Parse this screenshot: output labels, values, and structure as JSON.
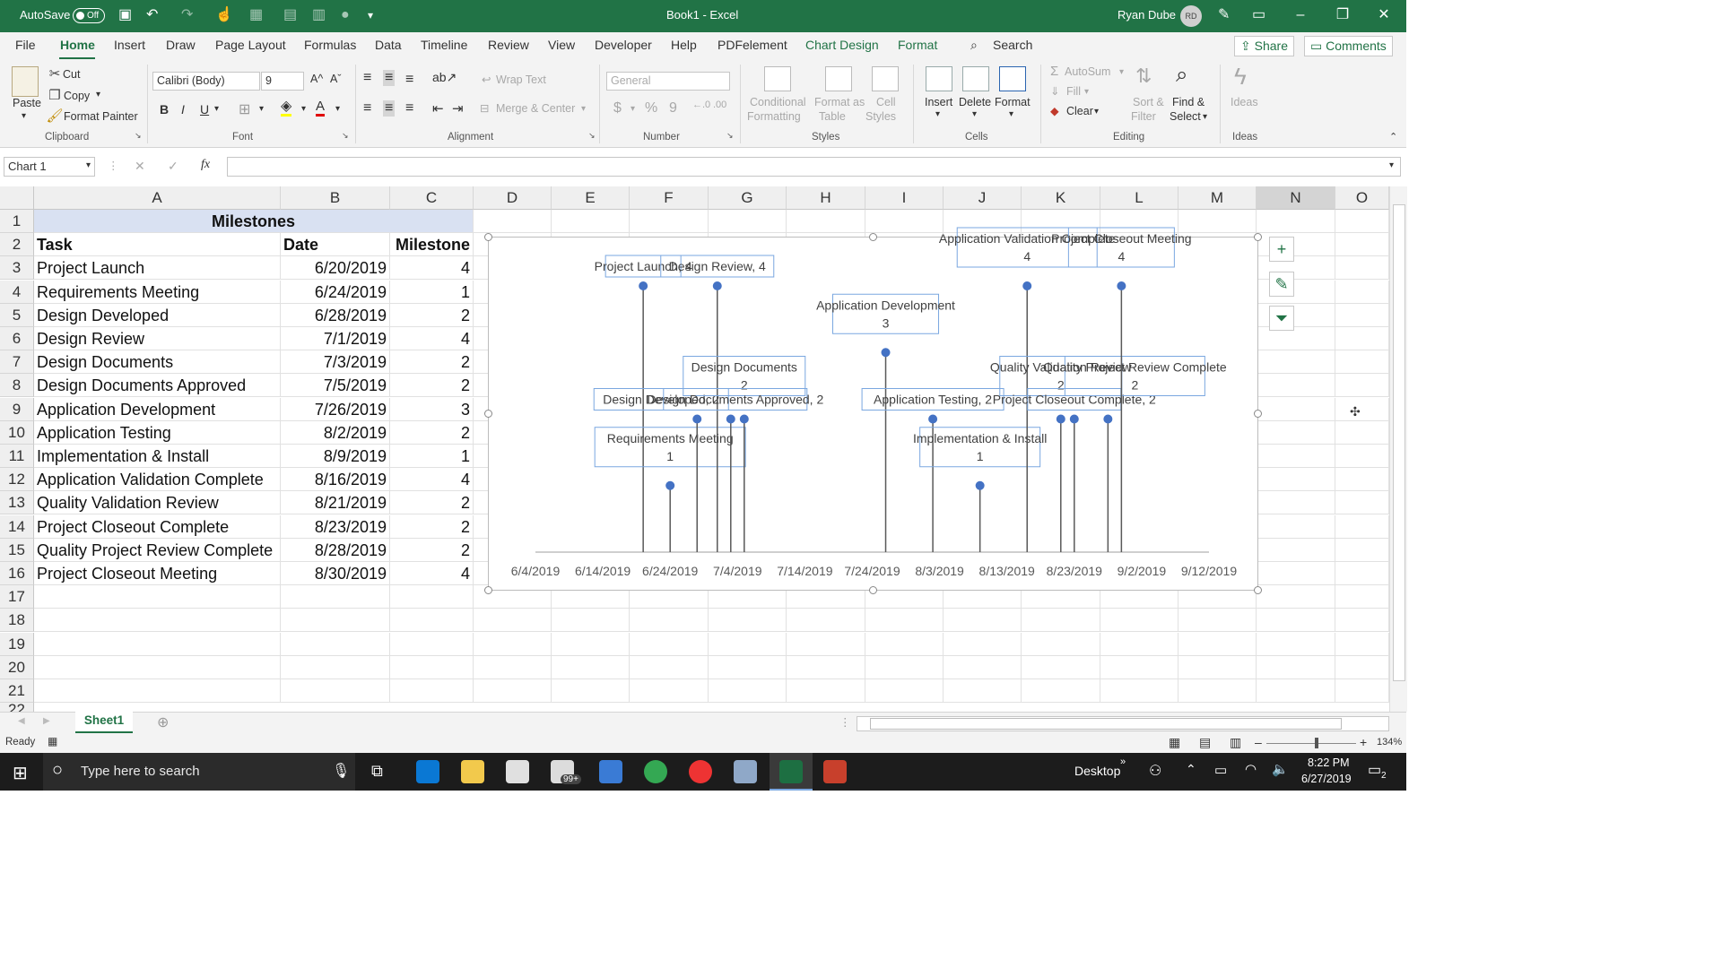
{
  "titlebar": {
    "autosave_label": "AutoSave",
    "autosave_state": "Off",
    "document_title": "Book1  -  Excel",
    "user_name": "Ryan Dube",
    "user_initials": "RD"
  },
  "menu": {
    "tabs": [
      "File",
      "Home",
      "Insert",
      "Draw",
      "Page Layout",
      "Formulas",
      "Data",
      "Timeline",
      "Review",
      "View",
      "Developer",
      "Help",
      "PDFelement",
      "Chart Design",
      "Format"
    ],
    "active": "Home",
    "search_label": "Search",
    "share_label": "Share",
    "comments_label": "Comments"
  },
  "ribbon": {
    "clipboard": {
      "paste": "Paste",
      "cut": "Cut",
      "copy": "Copy",
      "format_painter": "Format Painter",
      "group": "Clipboard"
    },
    "font": {
      "name": "Calibri (Body)",
      "size": "9",
      "bold": "B",
      "italic": "I",
      "underline": "U",
      "group": "Font"
    },
    "alignment": {
      "wrap_text": "Wrap Text",
      "merge_center": "Merge & Center",
      "group": "Alignment"
    },
    "number": {
      "format": "General",
      "currency": "$",
      "percent": "%",
      "comma": "9",
      "group": "Number"
    },
    "styles": {
      "conditional_1": "Conditional",
      "conditional_2": "Formatting",
      "table_1": "Format as",
      "table_2": "Table",
      "cell_1": "Cell",
      "cell_2": "Styles",
      "group": "Styles"
    },
    "cells": {
      "insert": "Insert",
      "delete": "Delete",
      "format": "Format",
      "group": "Cells"
    },
    "editing": {
      "autosum": "AutoSum",
      "fill": "Fill",
      "clear": "Clear",
      "sort_1": "Sort &",
      "sort_2": "Filter",
      "find_1": "Find &",
      "find_2": "Select",
      "group": "Editing"
    },
    "ideas": {
      "label": "Ideas",
      "group": "Ideas"
    }
  },
  "formula_bar": {
    "name_box": "Chart 1",
    "cancel": "✕",
    "enter": "✓",
    "fx": "fx",
    "value": ""
  },
  "grid": {
    "columns": [
      "A",
      "B",
      "C",
      "D",
      "E",
      "F",
      "G",
      "H",
      "I",
      "J",
      "K",
      "L",
      "M",
      "N",
      "O"
    ],
    "rows": [
      "1",
      "2",
      "3",
      "4",
      "5",
      "6",
      "7",
      "8",
      "9",
      "10",
      "11",
      "12",
      "13",
      "14",
      "15",
      "16",
      "17",
      "18",
      "19",
      "20",
      "21",
      "22"
    ],
    "title": "Milestones",
    "headers": [
      "Task",
      "Date",
      "Milestone"
    ],
    "data": [
      [
        "Project Launch",
        "6/20/2019",
        "4"
      ],
      [
        "Requirements Meeting",
        "6/24/2019",
        "1"
      ],
      [
        "Design Developed",
        "6/28/2019",
        "2"
      ],
      [
        "Design Review",
        "7/1/2019",
        "4"
      ],
      [
        "Design Documents",
        "7/3/2019",
        "2"
      ],
      [
        "Design Documents Approved",
        "7/5/2019",
        "2"
      ],
      [
        "Application Development",
        "7/26/2019",
        "3"
      ],
      [
        "Application Testing",
        "8/2/2019",
        "2"
      ],
      [
        "Implementation & Install",
        "8/9/2019",
        "1"
      ],
      [
        "Application Validation Complete",
        "8/16/2019",
        "4"
      ],
      [
        "Quality Validation Review",
        "8/21/2019",
        "2"
      ],
      [
        "Project Closeout Complete",
        "8/23/2019",
        "2"
      ],
      [
        "Quality Project Review Complete",
        "8/28/2019",
        "2"
      ],
      [
        "Project Closeout Meeting",
        "8/30/2019",
        "4"
      ]
    ]
  },
  "chart_data": {
    "type": "scatter",
    "xlim": [
      "6/4/2019",
      "9/12/2019"
    ],
    "x_ticks": [
      "6/4/2019",
      "6/14/2019",
      "6/24/2019",
      "7/4/2019",
      "7/14/2019",
      "7/24/2019",
      "8/3/2019",
      "8/13/2019",
      "8/23/2019",
      "9/2/2019",
      "9/12/2019"
    ],
    "points": [
      {
        "label": "Project Launch, 4",
        "x": "6/20/2019",
        "y": 4
      },
      {
        "label": "Requirements Meeting, 1",
        "x": "6/24/2019",
        "y": 1
      },
      {
        "label": "Design Developed, 2",
        "x": "6/28/2019",
        "y": 2
      },
      {
        "label": "Design Review, 4",
        "x": "7/1/2019",
        "y": 4
      },
      {
        "label": "Design Documents, 2",
        "x": "7/3/2019",
        "y": 2
      },
      {
        "label": "Design Documents Approved, 2",
        "x": "7/5/2019",
        "y": 2
      },
      {
        "label": "Application Development, 3",
        "x": "7/26/2019",
        "y": 3
      },
      {
        "label": "Application Testing, 2",
        "x": "8/2/2019",
        "y": 2
      },
      {
        "label": "Implementation & Install, 1",
        "x": "8/9/2019",
        "y": 1
      },
      {
        "label": "Application Validation Complete, 4",
        "x": "8/16/2019",
        "y": 4
      },
      {
        "label": "Quality Validation Review, 2",
        "x": "8/21/2019",
        "y": 2
      },
      {
        "label": "Project Closeout Complete, 2",
        "x": "8/23/2019",
        "y": 2
      },
      {
        "label": "Quality Project Review Complete, 2",
        "x": "8/28/2019",
        "y": 2
      },
      {
        "label": "Project Closeout Meeting, 4",
        "x": "8/30/2019",
        "y": 4
      }
    ],
    "drop_lines": true,
    "grid": false,
    "marker_color": "#4472c4"
  },
  "sheets": {
    "active": "Sheet1"
  },
  "status": {
    "ready": "Ready",
    "zoom": "134%"
  },
  "taskbar": {
    "search_placeholder": "Type here to search",
    "desktop": "Desktop",
    "time": "8:22 PM",
    "date": "6/27/2019",
    "mail_badge": "99+",
    "notification_count": "2"
  },
  "colors": {
    "excel_green": "#217346",
    "marker": "#4472c4",
    "title_fill": "#d9e1f2"
  }
}
